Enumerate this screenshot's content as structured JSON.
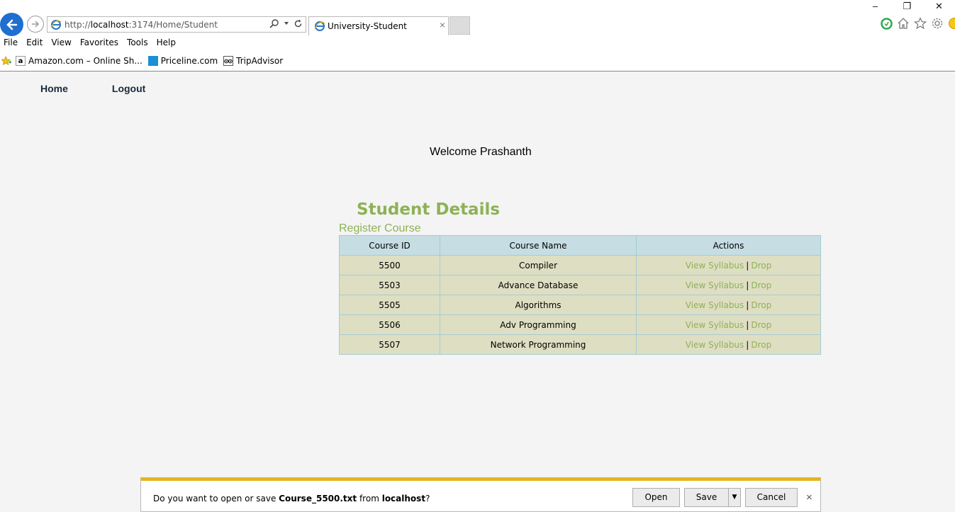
{
  "browser": {
    "url_prefix": "http://",
    "url_host": "localhost",
    "url_rest": ":3174/Home/Student",
    "tab_title": "University-Student",
    "tab_close": "×",
    "window_controls": [
      "–",
      "❐",
      "✕"
    ],
    "menu": [
      "File",
      "Edit",
      "View",
      "Favorites",
      "Tools",
      "Help"
    ],
    "favorites": [
      {
        "label": "Amazon.com – Online Sh...",
        "icon": "amazon-icon"
      },
      {
        "label": "Priceline.com",
        "icon": "priceline-icon"
      },
      {
        "label": "TripAdvisor",
        "icon": "tripadvisor-icon"
      }
    ]
  },
  "site": {
    "nav": {
      "home": "Home",
      "logout": "Logout"
    },
    "welcome": "Welcome Prashanth",
    "heading": "Student Details",
    "register_link": "Register Course",
    "table": {
      "headers": [
        "Course ID",
        "Course Name",
        "Actions"
      ],
      "rows": [
        {
          "id": "5500",
          "name": "Compiler",
          "view": "View Syllabus",
          "sep": "|",
          "drop": "Drop"
        },
        {
          "id": "5503",
          "name": "Advance Database",
          "view": "View Syllabus",
          "sep": "|",
          "drop": "Drop"
        },
        {
          "id": "5505",
          "name": "Algorithms",
          "view": "View Syllabus",
          "sep": "|",
          "drop": "Drop"
        },
        {
          "id": "5506",
          "name": "Adv Programming",
          "view": "View Syllabus",
          "sep": "|",
          "drop": "Drop"
        },
        {
          "id": "5507",
          "name": "Network Programming",
          "view": "View Syllabus",
          "sep": "|",
          "drop": "Drop"
        }
      ]
    }
  },
  "download": {
    "msg_pre": "Do you want to open or save ",
    "file": "Course_5500.txt",
    "msg_mid": " from ",
    "host": "localhost",
    "msg_post": "?",
    "open": "Open",
    "save": "Save",
    "save_arrow": "▼",
    "cancel": "Cancel",
    "close": "×"
  },
  "colors": {
    "accent_green": "#8db255",
    "table_header": "#c5dde3",
    "table_row": "#dedec3",
    "download_bar_accent": "#e6b422"
  }
}
